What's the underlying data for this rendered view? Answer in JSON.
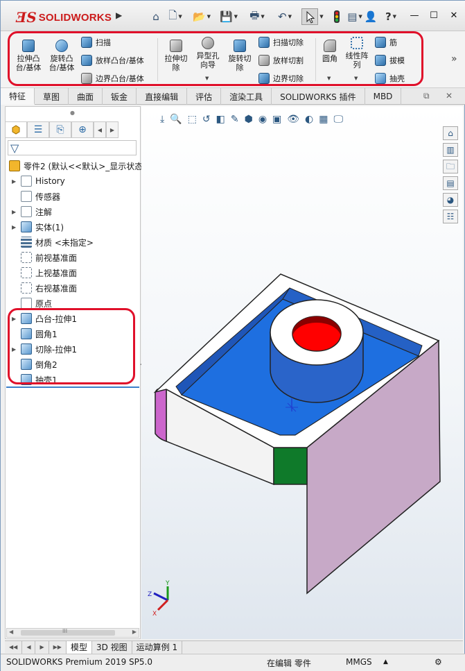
{
  "app": {
    "logo_ds": "ƎS",
    "logo_name": "SOLIDWORKS"
  },
  "quick_access": {
    "help": "?"
  },
  "command_manager": {
    "extruded_boss": "拉伸凸\n台/基体",
    "revolved_boss": "旋转凸\n台/基体",
    "swept_boss": "扫描",
    "lofted_boss": "放样凸台/基体",
    "boundary_boss": "边界凸台/基体",
    "extruded_cut": "拉伸切\n除",
    "hole_wizard": "异型孔\n向导",
    "revolved_cut": "旋转切\n除",
    "swept_cut": "扫描切除",
    "lofted_cut": "放样切割",
    "boundary_cut": "边界切除",
    "fillet": "圆角",
    "linear_pattern": "线性阵\n列",
    "rib": "筋",
    "draft": "拔模",
    "shell": "抽壳"
  },
  "tabs": [
    "特征",
    "草图",
    "曲面",
    "钣金",
    "直接编辑",
    "评估",
    "渲染工具",
    "SOLIDWORKS 插件",
    "MBD"
  ],
  "tree": {
    "root": "零件2 (默认<<默认>_显示状态",
    "items": [
      {
        "label": "History",
        "caret": true
      },
      {
        "label": "传感器",
        "caret": false
      },
      {
        "label": "注解",
        "caret": true
      },
      {
        "label": "实体(1)",
        "caret": true
      },
      {
        "label": "材质 <未指定>",
        "caret": false
      },
      {
        "label": "前视基准面",
        "caret": false
      },
      {
        "label": "上视基准面",
        "caret": false
      },
      {
        "label": "右视基准面",
        "caret": false
      },
      {
        "label": "原点",
        "caret": false
      },
      {
        "label": "凸台-拉伸1",
        "caret": true
      },
      {
        "label": "圆角1",
        "caret": false
      },
      {
        "label": "切除-拉伸1",
        "caret": true
      },
      {
        "label": "倒角2",
        "caret": false
      },
      {
        "label": "抽壳1",
        "caret": false
      }
    ]
  },
  "triad": {
    "x": "X",
    "y": "Y",
    "z": "Z"
  },
  "scroll_marker": "III",
  "bottom_tabs": [
    "模型",
    "3D 视图",
    "运动算例 1"
  ],
  "status": {
    "product": "SOLIDWORKS Premium 2019 SP5.0",
    "mode": "在编辑 零件",
    "units": "MMGS",
    "units_arrow": "▲"
  },
  "colors": {
    "accent_red": "#e0102a",
    "brand_red": "#cc1b1b",
    "part_blue": "#1e6fe0",
    "part_side_blue": "#1f56b8",
    "hole_red": "#ff0000",
    "face_green": "#0f7a2a",
    "face_magenta": "#cc66cc",
    "face_lavender": "#c7a9c7"
  }
}
